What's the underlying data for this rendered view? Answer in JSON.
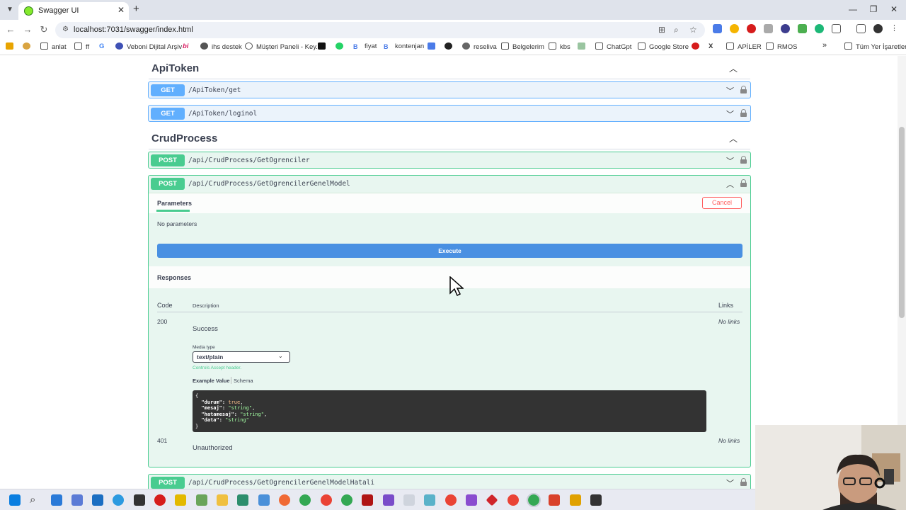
{
  "browser": {
    "tab_title": "Swagger UI",
    "tab_close": "✕",
    "new_tab": "+",
    "url": "localhost:7031/swagger/index.html",
    "bookmarks": [
      "anlat",
      "ff",
      "Veboni Dijital Arşiv",
      "ihs destek",
      "Müşteri Paneli - Key...",
      "fiyat",
      "kontenjan",
      "reseliva",
      "Belgelerim",
      "kbs",
      "ChatGpt",
      "Google Store",
      "APİLER",
      "RMOS",
      "Tüm Yer İşaretleri"
    ],
    "bookmarks_more": "»"
  },
  "sections": [
    {
      "title": "ApiToken",
      "operations": [
        {
          "method": "GET",
          "path": "/ApiToken/get"
        },
        {
          "method": "GET",
          "path": "/ApiToken/loginol"
        }
      ]
    },
    {
      "title": "CrudProcess",
      "operations": [
        {
          "method": "POST",
          "path": "/api/CrudProcess/GetOgrenciler"
        },
        {
          "method": "POST",
          "path": "/api/CrudProcess/GetOgrencilerGenelModel"
        },
        {
          "method": "POST",
          "path": "/api/CrudProcess/GetOgrencilerGenelModelHatali"
        }
      ]
    }
  ],
  "expanded": {
    "parameters_tab": "Parameters",
    "cancel_label": "Cancel",
    "no_parameters": "No parameters",
    "execute_label": "Execute",
    "responses_title": "Responses",
    "columns": {
      "code": "Code",
      "description": "Description",
      "links": "Links"
    },
    "responses": [
      {
        "code": "200",
        "description": "Success",
        "links": "No links"
      },
      {
        "code": "401",
        "description": "Unauthorized",
        "links": "No links"
      }
    ],
    "media_type_label": "Media type",
    "media_type_value": "text/plain",
    "media_hint": "Controls Accept header.",
    "example_tab": "Example Value",
    "schema_tab": "Schema",
    "example_lines": [
      {
        "key": "",
        "value": "{"
      },
      {
        "key": "\"durum\"",
        "value": "true"
      },
      {
        "key": "\"mesaj\"",
        "value": "\"string\""
      },
      {
        "key": "\"hatamesaj\"",
        "value": "\"string\""
      },
      {
        "key": "\"data\"",
        "value": "\"string\""
      },
      {
        "key": "",
        "value": "}"
      }
    ]
  },
  "colors": {
    "get": "#61affe",
    "post": "#49cc90",
    "execute": "#4990e2",
    "cancel": "#ff6060"
  }
}
